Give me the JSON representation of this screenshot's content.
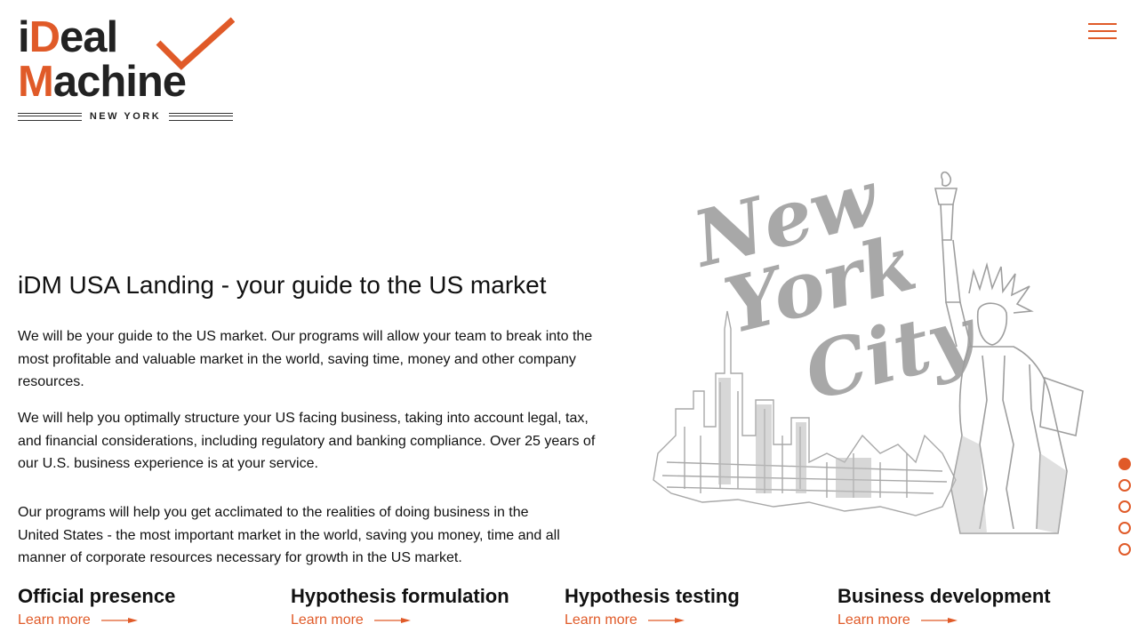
{
  "header": {
    "logo": {
      "line1_prefix": "i",
      "line1_accent": "D",
      "line1_rest": "eal",
      "line2_accent": "M",
      "line2_rest": "achine",
      "city": "NEW YORK"
    },
    "menu_icon": "hamburger-icon"
  },
  "hero": {
    "title": "iDM USA Landing - your guide to the US market",
    "paragraphs": [
      "We will be your guide to the US market. Our programs will allow your team to break into the most profitable and valuable market in the world, saving time, money and other company resources.",
      "We will help you optimally structure your US facing business, taking into account legal, tax, and financial considerations, including regulatory and banking compliance. Over 25 years of our U.S. business experience is at your service.",
      "Our programs will help you get acclimated to the realities of doing business in the United States - the most important market in the world, saving you money, time and all manner of corporate resources necessary for growth in the US market."
    ],
    "illustration": {
      "lettering": [
        "New",
        "York",
        "City"
      ]
    }
  },
  "pager": {
    "count": 5,
    "active_index": 0
  },
  "services": [
    {
      "title": "Official presence",
      "link": "Learn more"
    },
    {
      "title": "Hypothesis formulation",
      "link": "Learn more"
    },
    {
      "title": "Hypothesis testing",
      "link": "Learn more"
    },
    {
      "title": "Business development",
      "link": "Learn more"
    }
  ],
  "colors": {
    "accent": "#e05a28",
    "text": "#111111",
    "illustration": "#a8a8a8"
  }
}
